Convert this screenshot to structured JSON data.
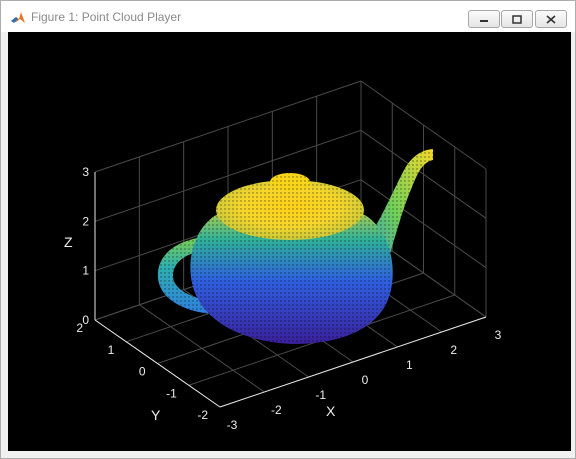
{
  "window": {
    "title": "Figure 1: Point Cloud Player",
    "buttons": [
      "minimize",
      "maximize",
      "close"
    ]
  },
  "axes": {
    "x": {
      "label": "X",
      "ticks": [
        "-3",
        "-2",
        "-1",
        "0",
        "1",
        "2",
        "3"
      ]
    },
    "y": {
      "label": "Y",
      "ticks": [
        "-2",
        "-1",
        "0",
        "1",
        "2"
      ]
    },
    "z": {
      "label": "Z",
      "ticks": [
        "0",
        "1",
        "2",
        "3"
      ]
    },
    "background": "#000000",
    "grid": true
  },
  "point_cloud": {
    "subject": "teapot",
    "colormap": "parula"
  },
  "colors": {
    "low": "#3a1fb0",
    "mid": "#1fa5a0",
    "high": "#f8e21a"
  }
}
